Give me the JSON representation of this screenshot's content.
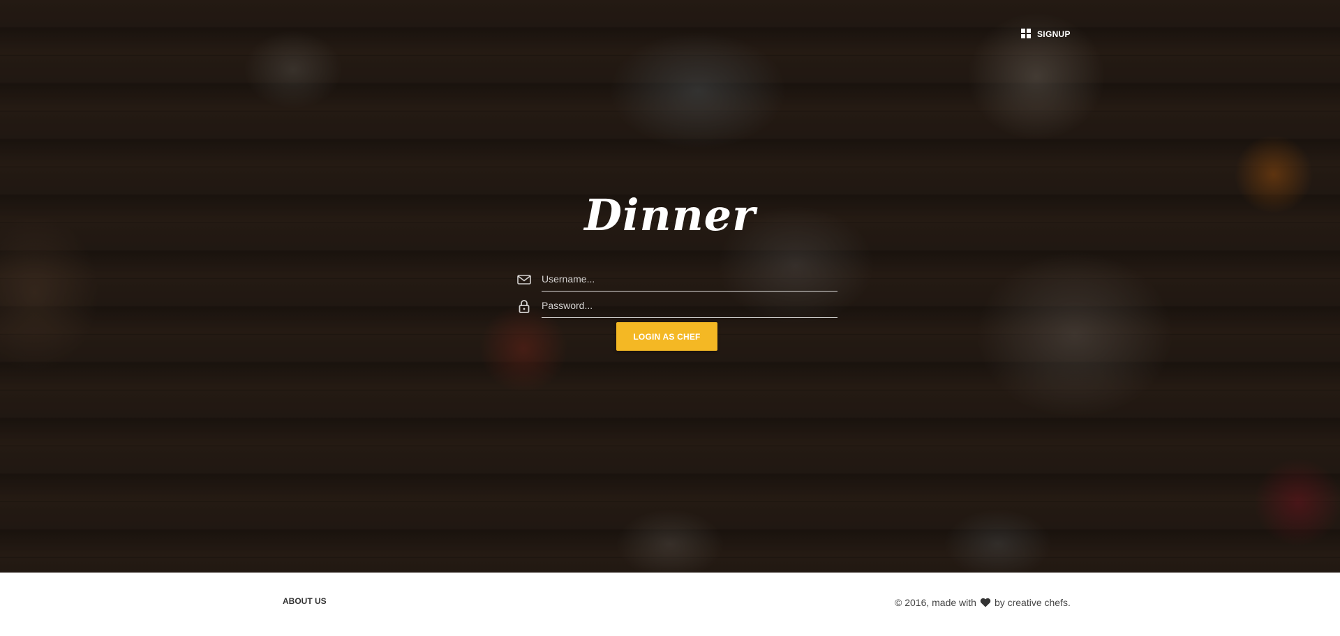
{
  "header": {
    "signup_label": "SIGNUP",
    "signup_icon": "grid-icon"
  },
  "brand": {
    "title": "Dinner"
  },
  "login_form": {
    "username_placeholder": "Username...",
    "username_icon": "mail-icon",
    "password_placeholder": "Password...",
    "password_icon": "lock-icon",
    "submit_label": "LOGIN AS CHEF",
    "accent_color": "#f4b824"
  },
  "footer": {
    "about_label": "ABOUT US",
    "copyright_prefix": "© 2016, made with",
    "copyright_icon": "heart-icon",
    "copyright_suffix": "by creative chefs."
  }
}
